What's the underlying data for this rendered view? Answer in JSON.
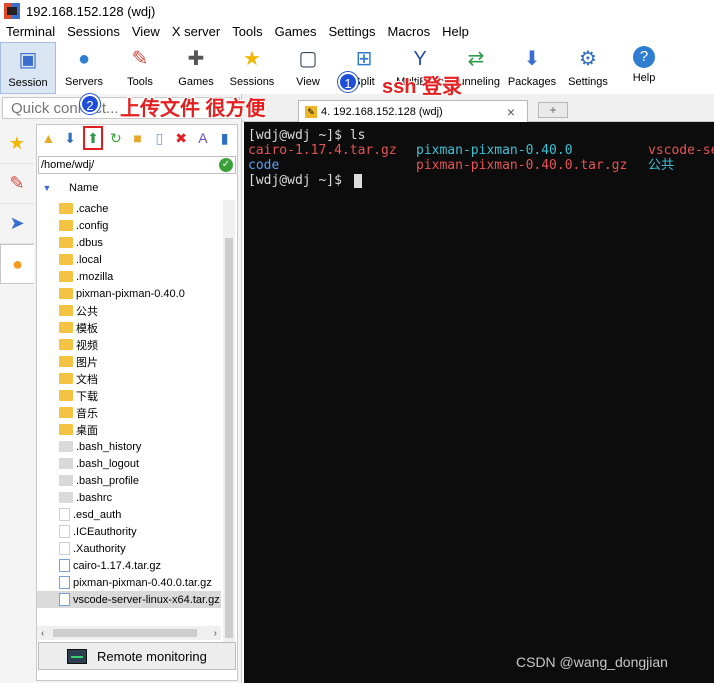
{
  "window": {
    "title": "192.168.152.128 (wdj)"
  },
  "menu": [
    "Terminal",
    "Sessions",
    "View",
    "X server",
    "Tools",
    "Games",
    "Settings",
    "Macros",
    "Help"
  ],
  "toolbar": [
    {
      "label": "Session",
      "icon": "session-icon"
    },
    {
      "label": "Servers",
      "icon": "servers-icon"
    },
    {
      "label": "Tools",
      "icon": "tools-icon"
    },
    {
      "label": "Games",
      "icon": "games-icon"
    },
    {
      "label": "Sessions",
      "icon": "sessions-star-icon"
    },
    {
      "label": "View",
      "icon": "view-icon"
    },
    {
      "label": "Split",
      "icon": "split-icon"
    },
    {
      "label": "MultiExec",
      "icon": "multiexec-icon"
    },
    {
      "label": "Tunneling",
      "icon": "tunneling-icon"
    },
    {
      "label": "Packages",
      "icon": "packages-icon"
    },
    {
      "label": "Settings",
      "icon": "settings-icon"
    },
    {
      "label": "Help",
      "icon": "help-icon"
    }
  ],
  "quick_connect": {
    "placeholder": "Quick connect..."
  },
  "sftp": {
    "path": "/home/wdj/",
    "column": "Name",
    "files": [
      {
        "name": ".cache",
        "type": "folder"
      },
      {
        "name": ".config",
        "type": "folder"
      },
      {
        "name": ".dbus",
        "type": "folder"
      },
      {
        "name": ".local",
        "type": "folder"
      },
      {
        "name": ".mozilla",
        "type": "folder"
      },
      {
        "name": "pixman-pixman-0.40.0",
        "type": "folder"
      },
      {
        "name": "公共",
        "type": "folder"
      },
      {
        "name": "模板",
        "type": "folder"
      },
      {
        "name": "视频",
        "type": "folder"
      },
      {
        "name": "图片",
        "type": "folder"
      },
      {
        "name": "文档",
        "type": "folder"
      },
      {
        "name": "下载",
        "type": "folder"
      },
      {
        "name": "音乐",
        "type": "folder"
      },
      {
        "name": "桌面",
        "type": "folder"
      },
      {
        "name": ".bash_history",
        "type": "file"
      },
      {
        "name": ".bash_logout",
        "type": "file"
      },
      {
        "name": ".bash_profile",
        "type": "file"
      },
      {
        "name": ".bashrc",
        "type": "file"
      },
      {
        "name": ".esd_auth",
        "type": "blank"
      },
      {
        "name": ".ICEauthority",
        "type": "blank"
      },
      {
        "name": ".Xauthority",
        "type": "blank"
      },
      {
        "name": "cairo-1.17.4.tar.gz",
        "type": "archive"
      },
      {
        "name": "pixman-pixman-0.40.0.tar.gz",
        "type": "archive"
      },
      {
        "name": "vscode-server-linux-x64.tar.gz",
        "type": "archive",
        "selected": true
      }
    ],
    "remote_monitoring": "Remote monitoring"
  },
  "tab": {
    "title": "4. 192.168.152.128 (wdj)",
    "close": "×",
    "new": "+"
  },
  "terminal": {
    "line1_prompt": "[wdj@wdj ~]$ ls",
    "line2": [
      "cairo-1.17.4.tar.gz",
      "pixman-pixman-0.40.0",
      "vscode-se"
    ],
    "line3": [
      "code",
      "pixman-pixman-0.40.0.tar.gz",
      "公共"
    ],
    "line4_prompt": "[wdj@wdj ~]$ "
  },
  "annotations": {
    "badge1": "1",
    "label1": "ssh 登录",
    "badge2": "2",
    "label2": "上传文件 很方便"
  },
  "watermark": "CSDN @wang_dongjian"
}
